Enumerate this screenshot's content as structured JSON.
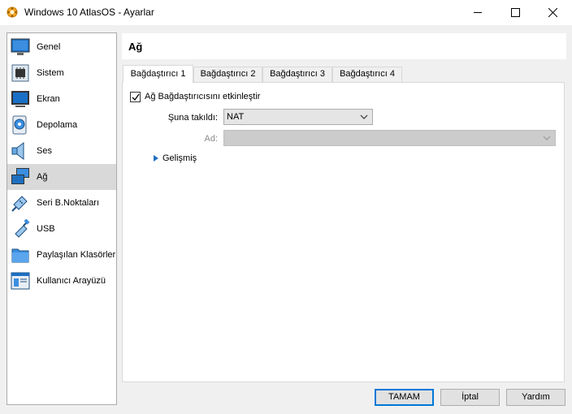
{
  "window": {
    "title": "Windows 10 AtlasOS - Ayarlar"
  },
  "sidebar": {
    "items": [
      {
        "label": "Genel",
        "icon": "monitor-general-icon"
      },
      {
        "label": "Sistem",
        "icon": "chip-icon"
      },
      {
        "label": "Ekran",
        "icon": "display-icon"
      },
      {
        "label": "Depolama",
        "icon": "disk-icon"
      },
      {
        "label": "Ses",
        "icon": "speaker-icon"
      },
      {
        "label": "Ağ",
        "icon": "network-icon",
        "selected": true
      },
      {
        "label": "Seri B.Noktaları",
        "icon": "serial-port-icon"
      },
      {
        "label": "USB",
        "icon": "usb-icon"
      },
      {
        "label": "Paylaşılan Klasörler",
        "icon": "folder-icon"
      },
      {
        "label": "Kullanıcı Arayüzü",
        "icon": "window-ui-icon"
      }
    ]
  },
  "main": {
    "title": "Ağ",
    "tabs": [
      {
        "label": "Bağdaştırıcı 1",
        "active": true
      },
      {
        "label": "Bağdaştırıcı 2"
      },
      {
        "label": "Bağdaştırıcı 3"
      },
      {
        "label": "Bağdaştırıcı 4"
      }
    ],
    "enable_checkbox": {
      "label": "Ağ Bağdaştırıcısını etkinleştir",
      "checked": true
    },
    "attached_to": {
      "label": "Şuna takıldı:",
      "value": "NAT"
    },
    "name": {
      "label": "Ad:",
      "value": ""
    },
    "advanced_label": "Gelişmiş"
  },
  "buttons": {
    "ok": "TAMAM",
    "cancel": "İptal",
    "help": "Yardım"
  },
  "colors": {
    "accent": "#0078d7",
    "selected_row": "#d9d9d9"
  }
}
